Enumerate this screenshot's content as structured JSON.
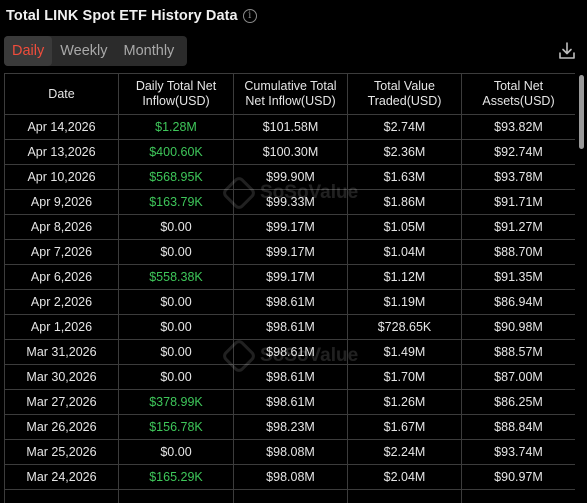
{
  "header": {
    "title": "Total LINK Spot ETF History Data",
    "info_icon": "info-icon",
    "download_icon": "download-icon"
  },
  "tabs": [
    {
      "label": "Daily",
      "active": true
    },
    {
      "label": "Weekly",
      "active": false
    },
    {
      "label": "Monthly",
      "active": false
    }
  ],
  "table": {
    "columns": [
      {
        "line1": "Date",
        "line2": ""
      },
      {
        "line1": "Daily Total Net",
        "line2": "Inflow(USD)"
      },
      {
        "line1": "Cumulative Total",
        "line2": "Net Inflow(USD)"
      },
      {
        "line1": "Total Value",
        "line2": "Traded(USD)"
      },
      {
        "line1": "Total Net",
        "line2": "Assets(USD)"
      }
    ],
    "rows": [
      [
        "Apr 14,2026",
        "$1.28M",
        "$101.58M",
        "$2.74M",
        "$93.82M"
      ],
      [
        "Apr 13,2026",
        "$400.60K",
        "$100.30M",
        "$2.36M",
        "$92.74M"
      ],
      [
        "Apr 10,2026",
        "$568.95K",
        "$99.90M",
        "$1.63M",
        "$93.78M"
      ],
      [
        "Apr 9,2026",
        "$163.79K",
        "$99.33M",
        "$1.86M",
        "$91.71M"
      ],
      [
        "Apr 8,2026",
        "$0.00",
        "$99.17M",
        "$1.05M",
        "$91.27M"
      ],
      [
        "Apr 7,2026",
        "$0.00",
        "$99.17M",
        "$1.04M",
        "$88.70M"
      ],
      [
        "Apr 6,2026",
        "$558.38K",
        "$99.17M",
        "$1.12M",
        "$91.35M"
      ],
      [
        "Apr 2,2026",
        "$0.00",
        "$98.61M",
        "$1.19M",
        "$86.94M"
      ],
      [
        "Apr 1,2026",
        "$0.00",
        "$98.61M",
        "$728.65K",
        "$90.98M"
      ],
      [
        "Mar 31,2026",
        "$0.00",
        "$98.61M",
        "$1.49M",
        "$88.57M"
      ],
      [
        "Mar 30,2026",
        "$0.00",
        "$98.61M",
        "$1.70M",
        "$87.00M"
      ],
      [
        "Mar 27,2026",
        "$378.99K",
        "$98.61M",
        "$1.26M",
        "$86.25M"
      ],
      [
        "Mar 26,2026",
        "$156.78K",
        "$98.23M",
        "$1.67M",
        "$88.84M"
      ],
      [
        "Mar 25,2026",
        "$0.00",
        "$98.08M",
        "$2.24M",
        "$93.74M"
      ],
      [
        "Mar 24,2026",
        "$165.29K",
        "$98.08M",
        "$2.04M",
        "$90.97M"
      ],
      [
        "",
        "",
        "",
        "",
        ""
      ]
    ],
    "positive_color": "#3ec75a"
  },
  "watermark": {
    "text": "SoSoValue"
  }
}
